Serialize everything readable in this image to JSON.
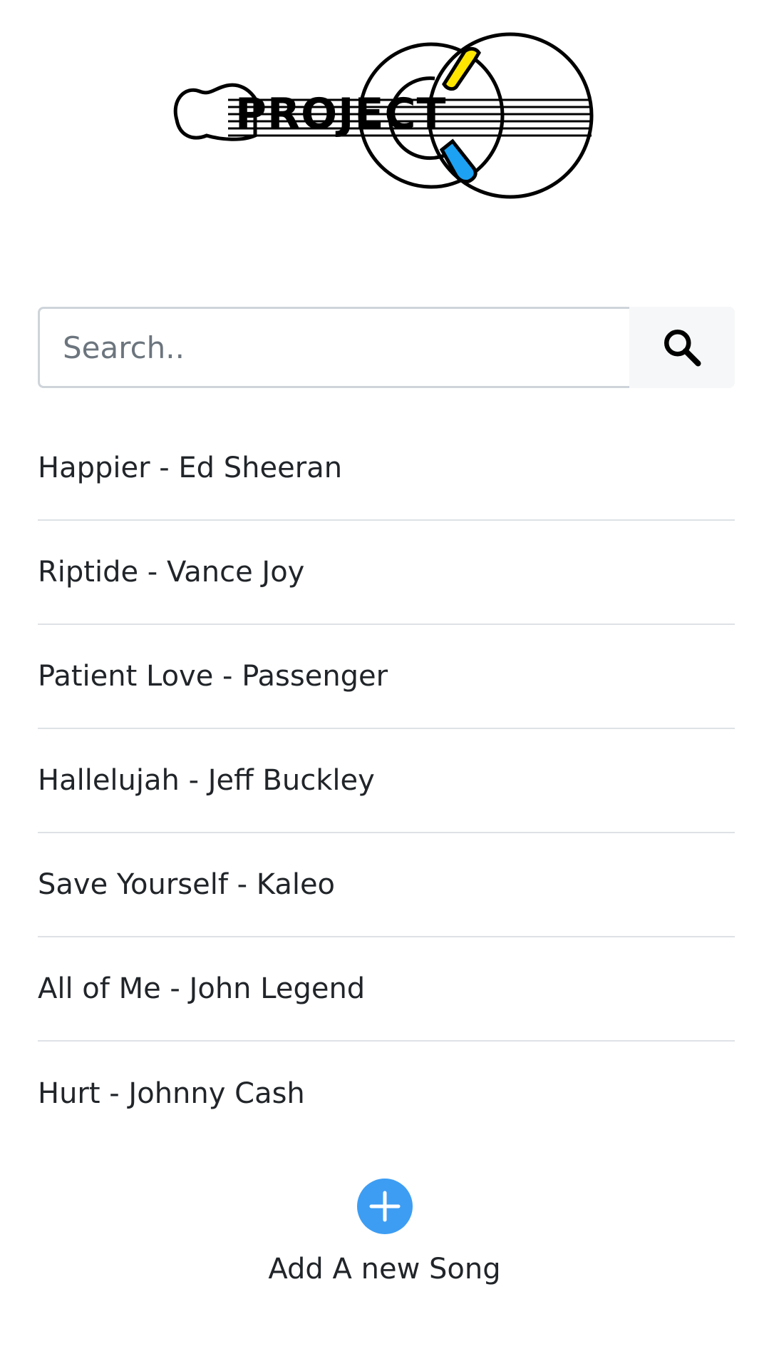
{
  "logo": {
    "text": "PROJECT"
  },
  "search": {
    "placeholder": "Search..",
    "value": ""
  },
  "songs": [
    {
      "label": "Happier - Ed Sheeran"
    },
    {
      "label": "Riptide - Vance Joy"
    },
    {
      "label": "Patient Love - Passenger"
    },
    {
      "label": "Hallelujah - Jeff Buckley"
    },
    {
      "label": "Save Yourself - Kaleo"
    },
    {
      "label": "All of Me - John Legend"
    },
    {
      "label": "Hurt - Johnny Cash"
    }
  ],
  "add": {
    "label": "Add A new Song"
  },
  "colors": {
    "accent": "#3d9df3",
    "logo_yellow": "#ffe600",
    "logo_blue": "#1da1f2",
    "divider": "#dee2e6"
  },
  "icons": {
    "search": "search-icon",
    "add": "plus-circle-icon"
  }
}
